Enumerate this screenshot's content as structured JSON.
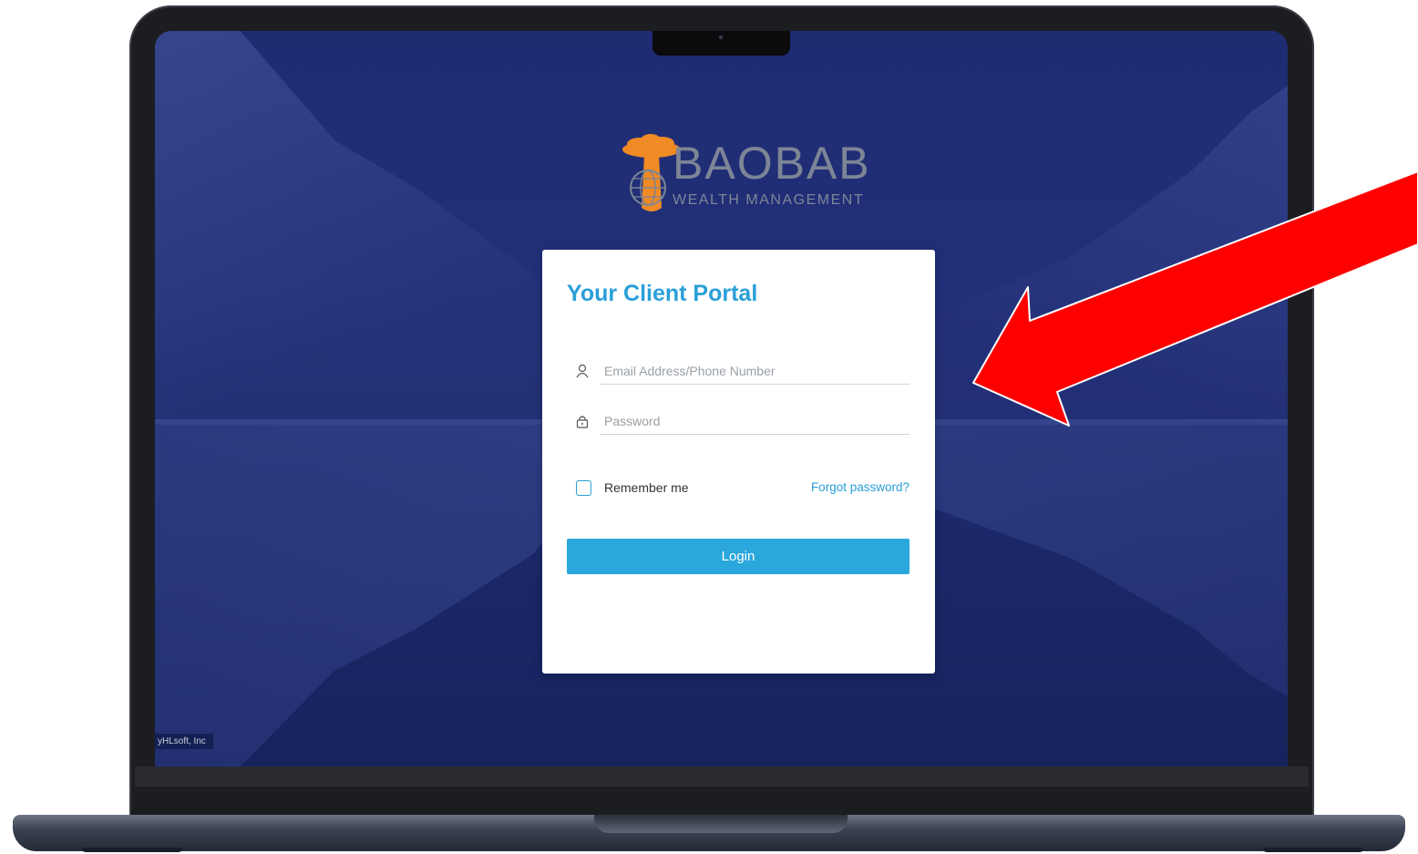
{
  "logo": {
    "brand": "BAOBAB",
    "tagline": "WEALTH MANAGEMENT"
  },
  "login": {
    "title": "Your Client Portal",
    "email_placeholder": "Email Address/Phone Number",
    "password_placeholder": "Password",
    "remember_label": "Remember me",
    "remember_checked": false,
    "forgot_label": "Forgot password?",
    "login_label": "Login"
  },
  "footer": {
    "credit": "yHLsoft, Inc"
  },
  "colors": {
    "accent": "#2aa7dd",
    "title": "#2a9fd8",
    "background": "#1e2c72",
    "logo_tree": "#f08a24",
    "annotation_arrow": "#ff0000"
  },
  "icons": {
    "email": "user-icon",
    "password": "lock-icon"
  }
}
